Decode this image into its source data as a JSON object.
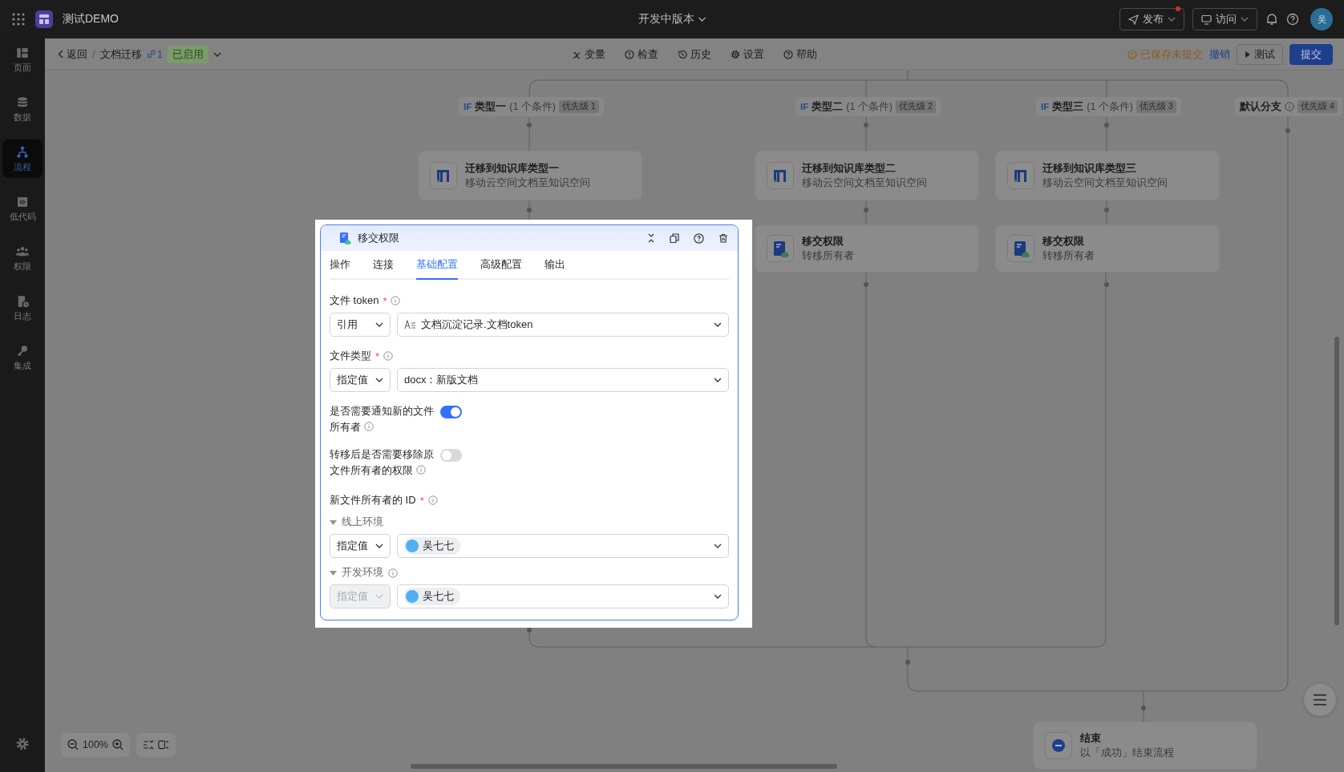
{
  "topbar": {
    "app_name": "测试DEMO",
    "version": "开发中版本",
    "publish": {
      "label": "发布",
      "has_notification": true
    },
    "visit": "访问",
    "avatar": "吴"
  },
  "sidebar": {
    "items": [
      {
        "label": "页面",
        "selected": false
      },
      {
        "label": "数据",
        "selected": false
      },
      {
        "label": "流程",
        "selected": true
      },
      {
        "label": "低代码",
        "selected": false
      },
      {
        "label": "权限",
        "selected": false
      },
      {
        "label": "日志",
        "selected": false
      },
      {
        "label": "集成",
        "selected": false
      }
    ]
  },
  "toolbar": {
    "back": "返回",
    "separator": "/",
    "flow_name": "文档迁移",
    "version_count": "1",
    "status": "已启用",
    "tools": [
      "变量",
      "检查",
      "历史",
      "设置",
      "帮助"
    ],
    "save_status": "已保存未提交",
    "undo": "撤销",
    "test": "测试",
    "submit": "提交"
  },
  "branches": [
    {
      "kind": "if",
      "prefix": "IF",
      "name": "类型一",
      "conditions": "(1 个条件)",
      "priority": "优先级 1"
    },
    {
      "kind": "if",
      "prefix": "IF",
      "name": "类型二",
      "conditions": "(1 个条件)",
      "priority": "优先级 2"
    },
    {
      "kind": "if",
      "prefix": "IF",
      "name": "类型三",
      "conditions": "(1 个条件)",
      "priority": "优先级 3"
    },
    {
      "kind": "default",
      "name": "默认分支",
      "priority": "优先级 4"
    }
  ],
  "nodes": [
    {
      "kind": "migrate",
      "title": "迁移到知识库类型一",
      "subtitle": "移动云空间文档至知识空间"
    },
    {
      "kind": "migrate",
      "title": "迁移到知识库类型二",
      "subtitle": "移动云空间文档至知识空间"
    },
    {
      "kind": "migrate",
      "title": "迁移到知识库类型三",
      "subtitle": "移动云空间文档至知识空间"
    },
    {
      "kind": "transfer",
      "title": "移交权限",
      "subtitle": "转移所有者"
    },
    {
      "kind": "transfer",
      "title": "移交权限",
      "subtitle": "转移所有者"
    }
  ],
  "end_node": {
    "title": "结束",
    "subtitle": "以「成功」结束流程"
  },
  "panel": {
    "title": "移交权限",
    "tabs": [
      {
        "label": "操作",
        "selected": false
      },
      {
        "label": "连接",
        "selected": false
      },
      {
        "label": "基础配置",
        "selected": true
      },
      {
        "label": "高级配置",
        "selected": false
      },
      {
        "label": "输出",
        "selected": false
      }
    ],
    "fields": [
      {
        "kind": "ref_select",
        "label": "文件 token",
        "required_mark": "*",
        "mode": "引用",
        "value": "文档沉淀记录.文档token"
      },
      {
        "kind": "select",
        "label": "文件类型",
        "required_mark": "*",
        "mode": "指定值",
        "value": "docx：新版文档"
      },
      {
        "kind": "toggle",
        "label": "是否需要通知新的文件所有者",
        "on": true
      },
      {
        "kind": "toggle",
        "label": "转移后是否需要移除原文件所有者的权限",
        "on": false
      },
      {
        "kind": "envs",
        "label": "新文件所有者的 ID",
        "required_mark": "*",
        "envs": [
          {
            "name": "线上环境",
            "expanded": true,
            "info": false,
            "mode": "指定值",
            "mode_disabled": false,
            "person": "吴七七"
          },
          {
            "name": "开发环境",
            "expanded": true,
            "info": true,
            "mode": "指定值",
            "mode_disabled": true,
            "person": "吴七七"
          }
        ]
      }
    ]
  },
  "zoom": "100%"
}
